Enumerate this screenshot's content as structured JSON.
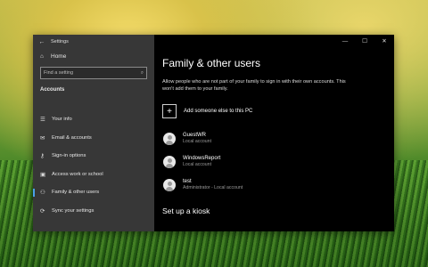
{
  "window": {
    "title": "Settings",
    "controls": [
      "minimize",
      "maximize",
      "close"
    ]
  },
  "sidebar": {
    "home": "Home",
    "search_placeholder": "Find a setting",
    "section": "Accounts",
    "items": [
      {
        "label": "Your info",
        "icon": "contact-card-icon"
      },
      {
        "label": "Email & accounts",
        "icon": "envelope-icon"
      },
      {
        "label": "Sign-in options",
        "icon": "key-icon"
      },
      {
        "label": "Access work or school",
        "icon": "briefcase-icon"
      },
      {
        "label": "Family & other users",
        "icon": "people-icon",
        "active": true
      },
      {
        "label": "Sync your settings",
        "icon": "sync-icon"
      }
    ]
  },
  "main": {
    "title": "Family & other users",
    "description": "Allow people who are not part of your family to sign in with their own accounts. This won't add them to your family.",
    "add_label": "Add someone else to this PC",
    "users": [
      {
        "name": "GuestWR",
        "role": "Local account"
      },
      {
        "name": "WindowsReport",
        "role": "Local account"
      },
      {
        "name": "test",
        "role": "Administrator - Local account"
      }
    ],
    "kiosk_title": "Set up a kiosk"
  },
  "colors": {
    "accent": "#4aa0e8",
    "sidebar_bg": "#3c3c3c",
    "main_bg": "#000000"
  }
}
